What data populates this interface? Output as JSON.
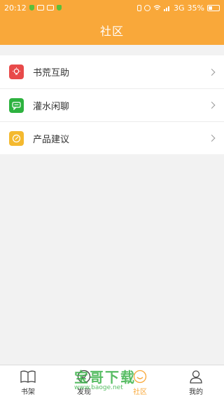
{
  "status_bar": {
    "time": "20:12",
    "network": "3G",
    "battery": "35%"
  },
  "header": {
    "title": "社区"
  },
  "menu": {
    "items": [
      {
        "label": "书荒互助",
        "icon": "lightbulb-icon",
        "color": "#e84a4a"
      },
      {
        "label": "灌水闲聊",
        "icon": "chat-bubble-icon",
        "color": "#2db23f"
      },
      {
        "label": "产品建议",
        "icon": "edit-circle-icon",
        "color": "#f4b92f"
      }
    ]
  },
  "tabbar": {
    "tabs": [
      {
        "label": "书架",
        "icon": "book-icon",
        "active": false
      },
      {
        "label": "发现",
        "icon": "compass-icon",
        "active": false
      },
      {
        "label": "社区",
        "icon": "community-icon",
        "active": true
      },
      {
        "label": "我的",
        "icon": "person-icon",
        "active": false
      }
    ]
  },
  "watermark": {
    "text": "宝哥下载",
    "url": "www.baoge.net"
  },
  "colors": {
    "accent": "#f9a83a"
  }
}
